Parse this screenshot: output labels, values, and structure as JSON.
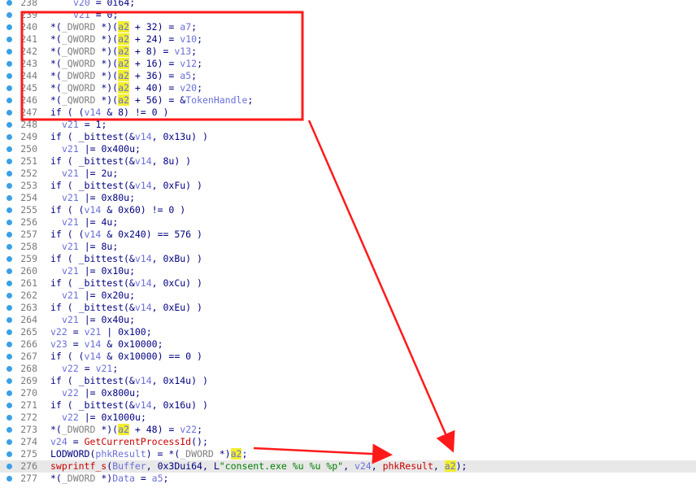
{
  "theme": {
    "accent": "#ff1a1a",
    "highlight": "#f2ee2c",
    "line_numbers": "#7a7a7a"
  },
  "code_lines": [
    {
      "ln": "238",
      "indent": 4,
      "tokens": [
        {
          "t": "v20",
          "c": "var"
        },
        {
          "t": " = 0i64;"
        }
      ]
    },
    {
      "ln": "239",
      "indent": 4,
      "tokens": [
        {
          "t": "v21",
          "c": "var"
        },
        {
          "t": " = 0;"
        }
      ]
    },
    {
      "ln": "240",
      "indent": 0,
      "tokens": [
        {
          "t": "*("
        },
        {
          "t": "_DWORD",
          "c": "cast"
        },
        {
          "t": " *)("
        },
        {
          "t": "a2",
          "c": "hit"
        },
        {
          "t": " + 32) = "
        },
        {
          "t": "a7",
          "c": "var"
        },
        {
          "t": ";"
        }
      ]
    },
    {
      "ln": "241",
      "indent": 0,
      "tokens": [
        {
          "t": "*("
        },
        {
          "t": "_QWORD",
          "c": "cast"
        },
        {
          "t": " *)("
        },
        {
          "t": "a2",
          "c": "hit"
        },
        {
          "t": " + 24) = "
        },
        {
          "t": "v10",
          "c": "var"
        },
        {
          "t": ";"
        }
      ]
    },
    {
      "ln": "242",
      "indent": 0,
      "tokens": [
        {
          "t": "*("
        },
        {
          "t": "_QWORD",
          "c": "cast"
        },
        {
          "t": " *)("
        },
        {
          "t": "a2",
          "c": "hit"
        },
        {
          "t": " + 8) = "
        },
        {
          "t": "v13",
          "c": "var"
        },
        {
          "t": ";"
        }
      ]
    },
    {
      "ln": "243",
      "indent": 0,
      "tokens": [
        {
          "t": "*("
        },
        {
          "t": "_QWORD",
          "c": "cast"
        },
        {
          "t": " *)("
        },
        {
          "t": "a2",
          "c": "hit"
        },
        {
          "t": " + 16) = "
        },
        {
          "t": "v12",
          "c": "var"
        },
        {
          "t": ";"
        }
      ]
    },
    {
      "ln": "244",
      "indent": 0,
      "tokens": [
        {
          "t": "*("
        },
        {
          "t": "_DWORD",
          "c": "cast"
        },
        {
          "t": " *)("
        },
        {
          "t": "a2",
          "c": "hit"
        },
        {
          "t": " + 36) = "
        },
        {
          "t": "a5",
          "c": "var"
        },
        {
          "t": ";"
        }
      ]
    },
    {
      "ln": "245",
      "indent": 0,
      "tokens": [
        {
          "t": "*("
        },
        {
          "t": "_QWORD",
          "c": "cast"
        },
        {
          "t": " *)("
        },
        {
          "t": "a2",
          "c": "hit"
        },
        {
          "t": " + 40) = "
        },
        {
          "t": "v20",
          "c": "var"
        },
        {
          "t": ";"
        }
      ]
    },
    {
      "ln": "246",
      "indent": 0,
      "tokens": [
        {
          "t": "*("
        },
        {
          "t": "_QWORD",
          "c": "cast"
        },
        {
          "t": " *)("
        },
        {
          "t": "a2",
          "c": "hit"
        },
        {
          "t": " + 56) = &"
        },
        {
          "t": "TokenHandle",
          "c": "var"
        },
        {
          "t": ";"
        }
      ]
    },
    {
      "ln": "247",
      "indent": 0,
      "tokens": [
        {
          "t": "if ( ("
        },
        {
          "t": "v14",
          "c": "var"
        },
        {
          "t": " & 8) != 0 )"
        }
      ]
    },
    {
      "ln": "248",
      "indent": 2,
      "tokens": [
        {
          "t": "v21",
          "c": "var"
        },
        {
          "t": " = 1;"
        }
      ]
    },
    {
      "ln": "249",
      "indent": 0,
      "tokens": [
        {
          "t": "if ( _bittest(&"
        },
        {
          "t": "v14",
          "c": "var"
        },
        {
          "t": ", 0x13u) )"
        }
      ]
    },
    {
      "ln": "250",
      "indent": 2,
      "tokens": [
        {
          "t": "v21",
          "c": "var"
        },
        {
          "t": " |= 0x400u;"
        }
      ]
    },
    {
      "ln": "251",
      "indent": 0,
      "tokens": [
        {
          "t": "if ( _bittest(&"
        },
        {
          "t": "v14",
          "c": "var"
        },
        {
          "t": ", 8u) )"
        }
      ]
    },
    {
      "ln": "252",
      "indent": 2,
      "tokens": [
        {
          "t": "v21",
          "c": "var"
        },
        {
          "t": " |= 2u;"
        }
      ]
    },
    {
      "ln": "253",
      "indent": 0,
      "tokens": [
        {
          "t": "if ( _bittest(&"
        },
        {
          "t": "v14",
          "c": "var"
        },
        {
          "t": ", 0xFu) )"
        }
      ]
    },
    {
      "ln": "254",
      "indent": 2,
      "tokens": [
        {
          "t": "v21",
          "c": "var"
        },
        {
          "t": " |= 0x80u;"
        }
      ]
    },
    {
      "ln": "255",
      "indent": 0,
      "tokens": [
        {
          "t": "if ( ("
        },
        {
          "t": "v14",
          "c": "var"
        },
        {
          "t": " & 0x60) != 0 )"
        }
      ]
    },
    {
      "ln": "256",
      "indent": 2,
      "tokens": [
        {
          "t": "v21",
          "c": "var"
        },
        {
          "t": " |= 4u;"
        }
      ]
    },
    {
      "ln": "257",
      "indent": 0,
      "tokens": [
        {
          "t": "if ( ("
        },
        {
          "t": "v14",
          "c": "var"
        },
        {
          "t": " & 0x240) == 576 )"
        }
      ]
    },
    {
      "ln": "258",
      "indent": 2,
      "tokens": [
        {
          "t": "v21",
          "c": "var"
        },
        {
          "t": " |= 8u;"
        }
      ]
    },
    {
      "ln": "259",
      "indent": 0,
      "tokens": [
        {
          "t": "if ( _bittest(&"
        },
        {
          "t": "v14",
          "c": "var"
        },
        {
          "t": ", 0xBu) )"
        }
      ]
    },
    {
      "ln": "260",
      "indent": 2,
      "tokens": [
        {
          "t": "v21",
          "c": "var"
        },
        {
          "t": " |= 0x10u;"
        }
      ]
    },
    {
      "ln": "261",
      "indent": 0,
      "tokens": [
        {
          "t": "if ( _bittest(&"
        },
        {
          "t": "v14",
          "c": "var"
        },
        {
          "t": ", 0xCu) )"
        }
      ]
    },
    {
      "ln": "262",
      "indent": 2,
      "tokens": [
        {
          "t": "v21",
          "c": "var"
        },
        {
          "t": " |= 0x20u;"
        }
      ]
    },
    {
      "ln": "263",
      "indent": 0,
      "tokens": [
        {
          "t": "if ( _bittest(&"
        },
        {
          "t": "v14",
          "c": "var"
        },
        {
          "t": ", 0xEu) )"
        }
      ]
    },
    {
      "ln": "264",
      "indent": 2,
      "tokens": [
        {
          "t": "v21",
          "c": "var"
        },
        {
          "t": " |= 0x40u;"
        }
      ]
    },
    {
      "ln": "265",
      "indent": 0,
      "tokens": [
        {
          "t": "v22",
          "c": "var"
        },
        {
          "t": " = "
        },
        {
          "t": "v21",
          "c": "var"
        },
        {
          "t": " | 0x100;"
        }
      ]
    },
    {
      "ln": "266",
      "indent": 0,
      "tokens": [
        {
          "t": "v23",
          "c": "var"
        },
        {
          "t": " = "
        },
        {
          "t": "v14",
          "c": "var"
        },
        {
          "t": " & 0x10000;"
        }
      ]
    },
    {
      "ln": "267",
      "indent": 0,
      "tokens": [
        {
          "t": "if ( ("
        },
        {
          "t": "v14",
          "c": "var"
        },
        {
          "t": " & 0x10000) == 0 )"
        }
      ]
    },
    {
      "ln": "268",
      "indent": 2,
      "tokens": [
        {
          "t": "v22",
          "c": "var"
        },
        {
          "t": " = "
        },
        {
          "t": "v21",
          "c": "var"
        },
        {
          "t": ";"
        }
      ]
    },
    {
      "ln": "269",
      "indent": 0,
      "tokens": [
        {
          "t": "if ( _bittest(&"
        },
        {
          "t": "v14",
          "c": "var"
        },
        {
          "t": ", 0x14u) )"
        }
      ]
    },
    {
      "ln": "270",
      "indent": 2,
      "tokens": [
        {
          "t": "v22",
          "c": "var"
        },
        {
          "t": " |= 0x800u;"
        }
      ]
    },
    {
      "ln": "271",
      "indent": 0,
      "tokens": [
        {
          "t": "if ( _bittest(&"
        },
        {
          "t": "v14",
          "c": "var"
        },
        {
          "t": ", 0x16u) )"
        }
      ]
    },
    {
      "ln": "272",
      "indent": 2,
      "tokens": [
        {
          "t": "v22",
          "c": "var"
        },
        {
          "t": " |= 0x1000u;"
        }
      ]
    },
    {
      "ln": "273",
      "indent": 0,
      "tokens": [
        {
          "t": "*("
        },
        {
          "t": "_DWORD",
          "c": "cast"
        },
        {
          "t": " *)("
        },
        {
          "t": "a2",
          "c": "hit"
        },
        {
          "t": " + 48) = "
        },
        {
          "t": "v22",
          "c": "var"
        },
        {
          "t": ";"
        }
      ]
    },
    {
      "ln": "274",
      "indent": 0,
      "tokens": [
        {
          "t": "v24",
          "c": "var"
        },
        {
          "t": " = "
        },
        {
          "t": "GetCurrentProcessId",
          "c": "call"
        },
        {
          "t": "();"
        }
      ]
    },
    {
      "ln": "275",
      "indent": 0,
      "tokens": [
        {
          "t": "LODWORD("
        },
        {
          "t": "phkResult",
          "c": "var"
        },
        {
          "t": ") = *("
        },
        {
          "t": "_DWORD",
          "c": "cast"
        },
        {
          "t": " *)"
        },
        {
          "t": "a2",
          "c": "hit"
        },
        {
          "t": ";"
        }
      ]
    },
    {
      "ln": "276",
      "indent": 0,
      "hl": true,
      "tokens": [
        {
          "t": "swprintf_s",
          "c": "call"
        },
        {
          "t": "("
        },
        {
          "t": "Buffer",
          "c": "var"
        },
        {
          "t": ", 0x3Dui64, L"
        },
        {
          "t": "\"consent.exe %u %u %p\"",
          "c": "str"
        },
        {
          "t": ", "
        },
        {
          "t": "v24",
          "c": "var"
        },
        {
          "t": ", "
        },
        {
          "t": "phkResult",
          "c": "call"
        },
        {
          "t": ", "
        },
        {
          "t": "a2",
          "c": "hit"
        },
        {
          "t": ");"
        }
      ]
    },
    {
      "ln": "277",
      "indent": 0,
      "tokens": [
        {
          "t": "*("
        },
        {
          "t": "_DWORD",
          "c": "cast"
        },
        {
          "t": " *)"
        },
        {
          "t": "Data",
          "c": "var"
        },
        {
          "t": " = "
        },
        {
          "t": "a5",
          "c": "var"
        },
        {
          "t": ";"
        }
      ]
    }
  ]
}
